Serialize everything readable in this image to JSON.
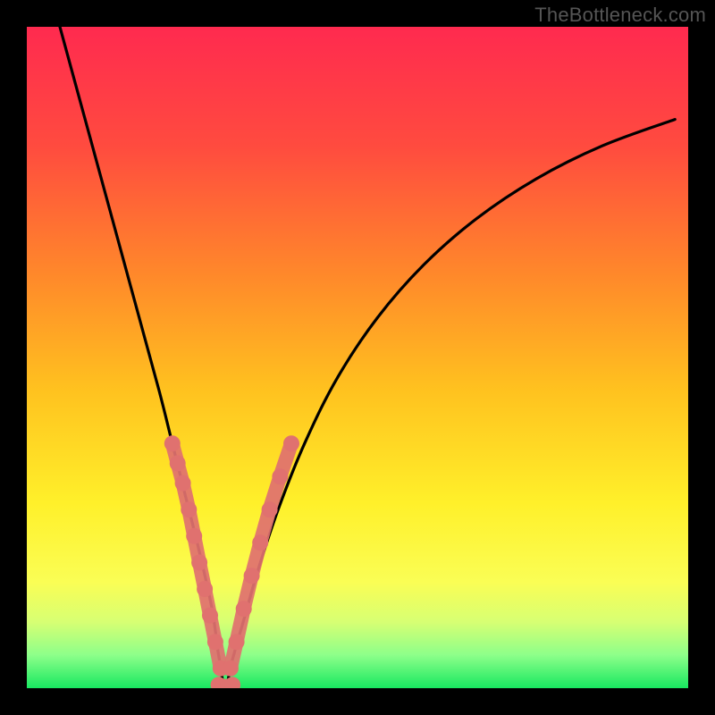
{
  "watermark": "TheBottleneck.com",
  "chart_data": {
    "type": "line",
    "title": "",
    "xlabel": "",
    "ylabel": "",
    "xlim": [
      0,
      100
    ],
    "ylim": [
      0,
      100
    ],
    "x_optimum": 30,
    "gradient_stops": [
      {
        "offset": 0.0,
        "color": "#ff2a4f"
      },
      {
        "offset": 0.18,
        "color": "#ff4b3f"
      },
      {
        "offset": 0.38,
        "color": "#ff8a2a"
      },
      {
        "offset": 0.55,
        "color": "#ffc21f"
      },
      {
        "offset": 0.72,
        "color": "#fff02a"
      },
      {
        "offset": 0.84,
        "color": "#fafe55"
      },
      {
        "offset": 0.9,
        "color": "#d7ff73"
      },
      {
        "offset": 0.95,
        "color": "#8dff8a"
      },
      {
        "offset": 1.0,
        "color": "#18e860"
      }
    ],
    "series": [
      {
        "name": "bottleneck-curve",
        "x": [
          5,
          8,
          11,
          14,
          17,
          20,
          22,
          24,
          26,
          28,
          29,
          30,
          31,
          33,
          35,
          38,
          42,
          47,
          53,
          60,
          68,
          77,
          87,
          98
        ],
        "y": [
          100,
          89,
          78,
          67,
          56,
          45,
          37,
          29,
          21,
          12,
          5,
          0,
          4,
          11,
          18,
          27,
          37,
          47,
          56,
          64,
          71,
          77,
          82,
          86
        ]
      }
    ],
    "data_points": {
      "left_branch": [
        {
          "x": 22.0,
          "y": 37
        },
        {
          "x": 22.8,
          "y": 34
        },
        {
          "x": 23.6,
          "y": 31
        },
        {
          "x": 24.5,
          "y": 27
        },
        {
          "x": 25.3,
          "y": 23
        },
        {
          "x": 26.1,
          "y": 19
        },
        {
          "x": 26.9,
          "y": 15
        },
        {
          "x": 27.7,
          "y": 11
        },
        {
          "x": 28.5,
          "y": 7
        },
        {
          "x": 29.3,
          "y": 3
        }
      ],
      "right_branch": [
        {
          "x": 30.8,
          "y": 3
        },
        {
          "x": 31.7,
          "y": 7
        },
        {
          "x": 32.8,
          "y": 12
        },
        {
          "x": 34.0,
          "y": 17
        },
        {
          "x": 35.3,
          "y": 22
        },
        {
          "x": 36.7,
          "y": 27
        },
        {
          "x": 38.3,
          "y": 32
        },
        {
          "x": 40.0,
          "y": 37
        }
      ],
      "bottom": [
        {
          "x": 29.0,
          "y": 0.5
        },
        {
          "x": 29.7,
          "y": 0.2
        },
        {
          "x": 30.4,
          "y": 0.2
        },
        {
          "x": 31.1,
          "y": 0.5
        }
      ]
    },
    "point_color": "#e0716f",
    "curve_color": "#000000"
  }
}
